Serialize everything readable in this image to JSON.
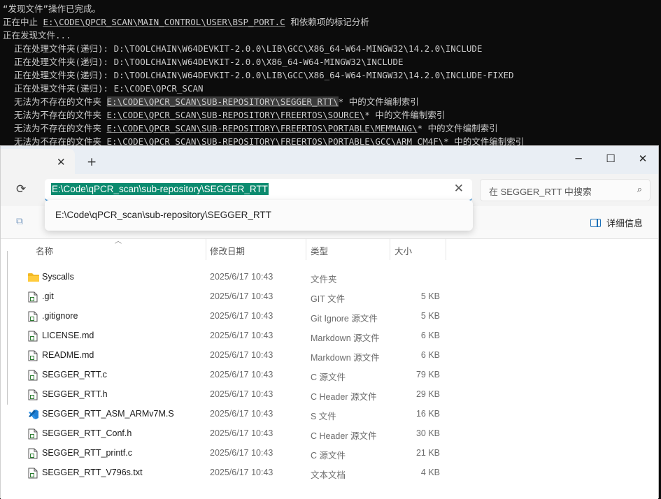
{
  "terminal": {
    "lines": [
      {
        "text": "“发现文件”操作已完成。"
      },
      {
        "prefix": "正在中止 ",
        "path": "E:\\CODE\\QPCR_SCAN\\MAIN_CONTROL\\USER\\BSP_PORT.C",
        "suffix": " 和依赖项的标记分析"
      },
      {
        "text": "正在发现文件..."
      },
      {
        "text": "正在处理文件夹(递归): D:\\TOOLCHAIN\\W64DEVKIT-2.0.0\\LIB\\GCC\\X86_64-W64-MINGW32\\14.2.0\\INCLUDE"
      },
      {
        "text": "正在处理文件夹(递归): D:\\TOOLCHAIN\\W64DEVKIT-2.0.0\\X86_64-W64-MINGW32\\INCLUDE"
      },
      {
        "text": "正在处理文件夹(递归): D:\\TOOLCHAIN\\W64DEVKIT-2.0.0\\LIB\\GCC\\X86_64-W64-MINGW32\\14.2.0\\INCLUDE-FIXED"
      },
      {
        "text": "正在处理文件夹(递归): E:\\CODE\\QPCR_SCAN"
      },
      {
        "prefix": "无法为不存在的文件夹 ",
        "path": "E:\\CODE\\QPCR_SCAN\\SUB-REPOSITORY\\SEGGER_RTT\\",
        "suffix": "* 中的文件编制索引"
      },
      {
        "prefix": "无法为不存在的文件夹 ",
        "path": "E:\\CODE\\QPCR_SCAN\\SUB-REPOSITORY\\FREERTOS\\SOURCE\\",
        "suffix": "* 中的文件编制索引"
      },
      {
        "prefix": "无法为不存在的文件夹 ",
        "path": "E:\\CODE\\QPCR_SCAN\\SUB-REPOSITORY\\FREERTOS\\PORTABLE\\MEMMANG\\",
        "suffix": "* 中的文件编制索引"
      },
      {
        "prefix": "无法为不存在的文件夹 ",
        "path": "E:\\CODE\\QPCR_SCAN\\SUB-REPOSITORY\\FREERTOS\\PORTABLE\\GCC\\ARM_CM4F\\",
        "suffix": "* 中的文件编制索引"
      }
    ]
  },
  "explorer": {
    "tab_close": "✕",
    "tab_add": "+",
    "window_controls": {
      "minimize": "─",
      "maximize": "☐",
      "close": "✕"
    },
    "address": {
      "value": "E:\\Code\\qPCR_scan\\sub-repository\\SEGGER_RTT",
      "clear": "✕"
    },
    "search": {
      "placeholder": "在 SEGGER_RTT 中搜索"
    },
    "suggestion": "E:\\Code\\qPCR_scan\\sub-repository\\SEGGER_RTT",
    "details_label": "详细信息",
    "columns": {
      "name": "名称",
      "date": "修改日期",
      "type": "类型",
      "size": "大小"
    },
    "files": [
      {
        "name": "Syscalls",
        "date": "2025/6/17 10:43",
        "type": "文件夹",
        "size": "",
        "icon": "folder-icon"
      },
      {
        "name": ".git",
        "date": "2025/6/17 10:43",
        "type": "GIT 文件",
        "size": "5 KB",
        "icon": "file-icon"
      },
      {
        "name": ".gitignore",
        "date": "2025/6/17 10:43",
        "type": "Git Ignore 源文件",
        "size": "5 KB",
        "icon": "file-icon"
      },
      {
        "name": "LICENSE.md",
        "date": "2025/6/17 10:43",
        "type": "Markdown 源文件",
        "size": "6 KB",
        "icon": "file-icon"
      },
      {
        "name": "README.md",
        "date": "2025/6/17 10:43",
        "type": "Markdown 源文件",
        "size": "6 KB",
        "icon": "file-icon"
      },
      {
        "name": "SEGGER_RTT.c",
        "date": "2025/6/17 10:43",
        "type": "C 源文件",
        "size": "79 KB",
        "icon": "file-icon"
      },
      {
        "name": "SEGGER_RTT.h",
        "date": "2025/6/17 10:43",
        "type": "C Header 源文件",
        "size": "29 KB",
        "icon": "file-icon"
      },
      {
        "name": "SEGGER_RTT_ASM_ARMv7M.S",
        "date": "2025/6/17 10:43",
        "type": "S 文件",
        "size": "16 KB",
        "icon": "vscode-file-icon"
      },
      {
        "name": "SEGGER_RTT_Conf.h",
        "date": "2025/6/17 10:43",
        "type": "C Header 源文件",
        "size": "30 KB",
        "icon": "file-icon"
      },
      {
        "name": "SEGGER_RTT_printf.c",
        "date": "2025/6/17 10:43",
        "type": "C 源文件",
        "size": "21 KB",
        "icon": "file-icon"
      },
      {
        "name": "SEGGER_RTT_V796s.txt",
        "date": "2025/6/17 10:43",
        "type": "文本文档",
        "size": "4 KB",
        "icon": "file-icon"
      }
    ]
  }
}
